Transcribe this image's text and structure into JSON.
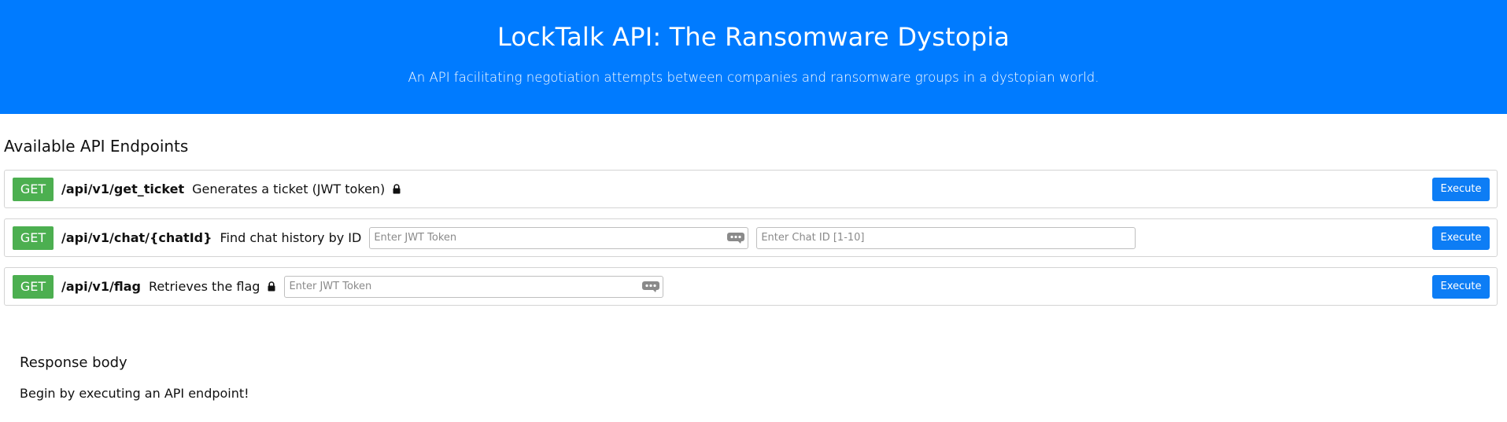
{
  "header": {
    "title": "LockTalk API: The Ransomware Dystopia",
    "subtitle": "An API facilitating negotiation attempts between companies and ransomware groups in a dystopian world."
  },
  "endpoints_section": {
    "title": "Available API Endpoints",
    "items": [
      {
        "method": "GET",
        "path": "/api/v1/get_ticket",
        "description": "Generates a ticket (JWT token)",
        "locked": true,
        "execute_label": "Execute"
      },
      {
        "method": "GET",
        "path": "/api/v1/chat/{chatId}",
        "description": "Find chat history by ID",
        "locked": false,
        "jwt_placeholder": "Enter JWT Token",
        "chat_id_placeholder": "Enter Chat ID [1-10]",
        "execute_label": "Execute"
      },
      {
        "method": "GET",
        "path": "/api/v1/flag",
        "description": "Retrieves the flag",
        "locked": true,
        "jwt_placeholder": "Enter JWT Token",
        "execute_label": "Execute"
      }
    ]
  },
  "response": {
    "title": "Response body",
    "body": "Begin by executing an API endpoint!"
  },
  "icons": {
    "lock": "lock-icon",
    "password_manager": "password-dots-icon"
  },
  "colors": {
    "header_bg": "#007bff",
    "method_get": "#4caf50",
    "execute_button": "#0d7df5"
  }
}
